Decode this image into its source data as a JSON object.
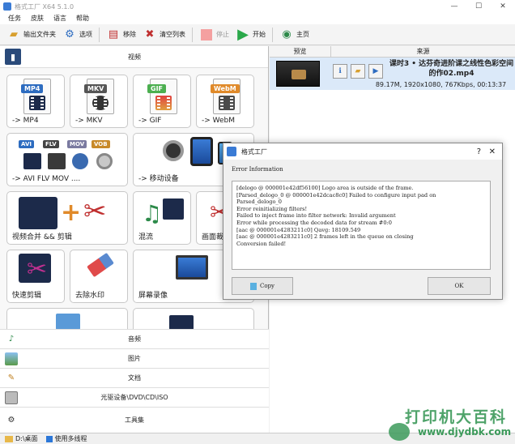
{
  "window": {
    "title": "格式工厂 X64 5.1.0",
    "minimize": "—",
    "maximize": "☐",
    "close": "✕"
  },
  "menu": [
    "任务",
    "皮肤",
    "语言",
    "帮助"
  ],
  "toolbar": {
    "output_folder": "输出文件夹",
    "options": "选项",
    "remove": "移除",
    "clear_list": "清空列表",
    "stop": "停止",
    "start": "开始",
    "home": "主页"
  },
  "left": {
    "video_label": "视频",
    "tiles": {
      "mp4": {
        "tag": "MP4",
        "label": "-> MP4"
      },
      "mkv": {
        "tag": "MKV",
        "label": "-> MKV"
      },
      "gif": {
        "tag": "GIF",
        "label": "-> GIF"
      },
      "webm": {
        "tag": "WebM",
        "label": "-> WebM"
      },
      "multi": {
        "tags": [
          "AVI",
          "FLV",
          "MOV",
          "VOB"
        ],
        "label": "-> AVI FLV MOV ...."
      },
      "mobile": {
        "label": "-> 移动设备"
      },
      "merge": {
        "label": "视频合并 && 剪辑"
      },
      "mix": {
        "label": "混流"
      },
      "crop": {
        "label": "画面裁剪"
      },
      "quick": {
        "label": "快速剪辑"
      },
      "watermark": {
        "label": "去除水印"
      },
      "screen": {
        "label": "屏幕录像"
      }
    },
    "categories": {
      "audio": "音频",
      "image": "图片",
      "document": "文档",
      "disc": "光驱设备\\DVD\\CD\\ISO",
      "tools": "工具集"
    }
  },
  "statusbar": {
    "path": "D:\\桌面",
    "multithread": "使用多线程"
  },
  "right": {
    "col_preview": "预览",
    "col_source": "来源",
    "file": {
      "name": "课时3 • 达芬奇进阶课之线性色彩空间的作02.mp4",
      "meta": "89.17M, 1920x1080, 767Kbps, 00:13:37"
    }
  },
  "dialog": {
    "title": "格式工厂",
    "heading": "Error Information",
    "message": "[delogo @ 000001e42df56100] Logo area is outside of the frame.\n[Parsed_delogo_0 @ 000001e42dcac8c0] Failed to configure input pad on\nParsed_delogo_0\nError reinitializing filters!\nFailed to inject frame into filter network: Invalid argument\nError while processing the decoded data for stream #0:0\n[aac @ 000001e4283211c0] Qavg: 18109.549\n[aac @ 000001e4283211c0] 2 frames left in the queue on closing\nConversion failed!",
    "copy_label": "Copy",
    "ok_label": "OK"
  },
  "watermark": {
    "text": "打印机大百科",
    "url": "www.djydbk.com"
  },
  "colors": {
    "mp4": "#2d6cc0",
    "mkv": "#555555",
    "gif": "#4caf50",
    "webm": "#e08a2a",
    "avi": "#2d6cc0",
    "flv": "#444444",
    "mov": "#7a7aa0",
    "vob": "#c88a2a",
    "start": "#2aa84a",
    "accent": "#3c9a5a"
  }
}
